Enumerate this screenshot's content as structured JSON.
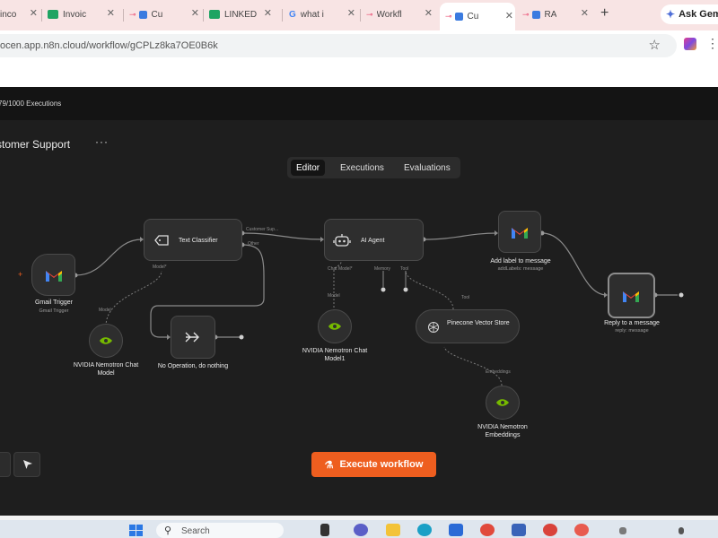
{
  "browser": {
    "tabs": [
      {
        "label": "Invoic",
        "icon": "sheets-icon"
      },
      {
        "label": "Cu",
        "icon": "n8n-icon"
      },
      {
        "label": "LINKED",
        "icon": "sheets-icon"
      },
      {
        "label": "what i",
        "icon": "google-icon"
      },
      {
        "label": "Workfl",
        "icon": "n8n-icon"
      },
      {
        "label": "Cu",
        "icon": "n8n-icon",
        "active": true
      },
      {
        "label": "RA",
        "icon": "n8n-icon"
      }
    ],
    "new_tab": "+",
    "ask_gemini": "Ask Gem",
    "url": "ocen.app.n8n.cloud/workflow/gCPLz8ka7OE0B6k"
  },
  "app": {
    "banner": "79/1000 Executions",
    "workflow_name": "stomer Support",
    "more": "···",
    "view_tabs": [
      "Editor",
      "Executions",
      "Evaluations"
    ],
    "active_view_tab": "Editor",
    "execute_button": "Execute workflow",
    "nodes": {
      "gmail_trigger": {
        "title": "Gmail Trigger",
        "subtitle": "Gmail Trigger"
      },
      "text_classifier": {
        "title": "Text Classifier",
        "out1": "Customer Sup...",
        "out2": "Other",
        "in1": "Model*"
      },
      "ai_agent": {
        "title": "AI Agent",
        "in1": "Chat Model*",
        "in2": "Memory",
        "in3": "Tool"
      },
      "add_label": {
        "title": "Add label to message",
        "subtitle": "addLabels: message"
      },
      "reply": {
        "title": "Reply to a message",
        "subtitle": "reply: message"
      },
      "no_op": {
        "title": "No Operation, do nothing"
      },
      "nvidia_chat_1": {
        "title": "NVIDIA Nemotron Chat Model",
        "conn": "Model"
      },
      "nvidia_chat_2": {
        "title": "NVIDIA Nemotron Chat Model1",
        "conn": "Model"
      },
      "pinecone": {
        "title": "Pinecone Vector Store",
        "conn_in": "Tool",
        "conn_out": "Embeddings"
      },
      "nvidia_embed": {
        "title": "NVIDIA Nemotron Embeddings",
        "conn": "Embeddings"
      }
    }
  },
  "taskbar": {
    "search_placeholder": "Search"
  },
  "colors": {
    "accent_orange": "#ee5e1f",
    "canvas_bg": "#1e1e1e",
    "node_bg": "#2e2e2e",
    "nvidia_green": "#76b900"
  }
}
